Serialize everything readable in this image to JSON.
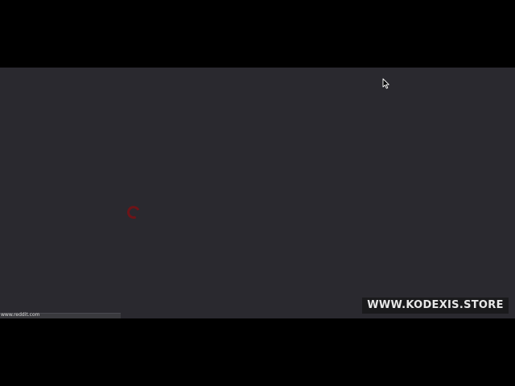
{
  "browser": {
    "status_url": "www.reddit.com",
    "loading": true
  },
  "watermark": {
    "text": "WWW.KODEXIS.STORE"
  },
  "colors": {
    "page_background": "#2a292f",
    "spinner": "#6e1418",
    "letterbox": "#000000"
  },
  "icons": {
    "spinner": "loading-spinner-icon",
    "cursor": "mouse-pointer-icon"
  }
}
